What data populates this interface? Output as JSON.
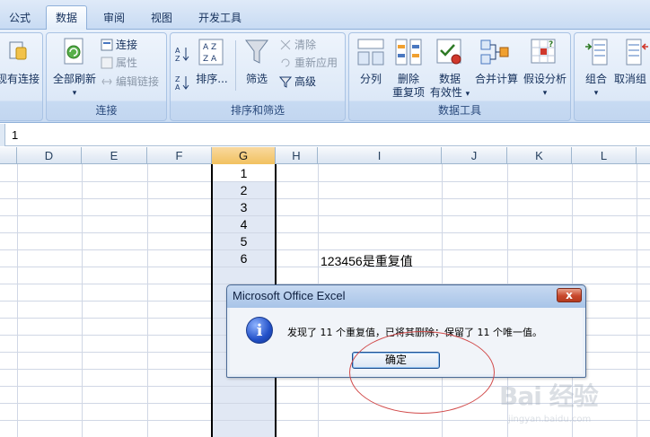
{
  "tabs": [
    "公式",
    "数据",
    "审阅",
    "视图",
    "开发工具"
  ],
  "active_tab": "数据",
  "ribbon": {
    "existing_connection": "现有连接",
    "groups": {
      "connections": {
        "label": "连接",
        "refresh_all": "全部刷新",
        "connections": "连接",
        "properties": "属性",
        "edit_links": "编辑链接"
      },
      "sort_filter": {
        "label": "排序和筛选",
        "sort": "排序...",
        "filter": "筛选",
        "clear": "清除",
        "reapply": "重新应用",
        "advanced": "高级"
      },
      "data_tools": {
        "label": "数据工具",
        "text_to_columns": "分列",
        "remove_duplicates_line1": "删除",
        "remove_duplicates_line2": "重复项",
        "data_validation_line1": "数据",
        "data_validation_line2": "有效性",
        "consolidate": "合并计算",
        "what_if": "假设分析"
      },
      "outline": {
        "group": "组合",
        "ungroup": "取消组"
      }
    }
  },
  "formula_bar": {
    "value": "1"
  },
  "columns": [
    "D",
    "E",
    "F",
    "G",
    "H",
    "I",
    "J",
    "K",
    "L"
  ],
  "selected_column": "G",
  "cells": {
    "G": [
      "1",
      "2",
      "3",
      "4",
      "5",
      "6"
    ],
    "note": "123456是重复值"
  },
  "dialog": {
    "title": "Microsoft Office Excel",
    "message": "发现了 11 个重复值，已将其删除；保留了 11 个唯一值。",
    "ok": "确定",
    "close": "x",
    "icon": "info-icon"
  },
  "watermark": {
    "text": "Bai 经验",
    "url": "jingyan.baidu.com"
  }
}
